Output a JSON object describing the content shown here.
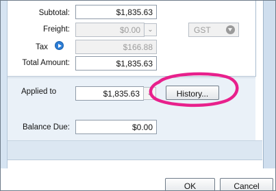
{
  "totals": {
    "subtotal_label": "Subtotal:",
    "subtotal_value": "$1,835.63",
    "freight_label": "Freight:",
    "freight_value": "$0.00",
    "freight_tax_code": "GST",
    "tax_label": "Tax",
    "tax_value": "$166.88",
    "total_label": "Total Amount:",
    "total_value": "$1,835.63"
  },
  "payment": {
    "applied_label": "Applied to",
    "applied_value": "$1,835.63",
    "history_button": "History...",
    "balance_label": "Balance Due:",
    "balance_value": "$0.00"
  },
  "footer": {
    "ok_button": "OK",
    "cancel_button": "Cancel"
  },
  "icons": {
    "tax_detail": "arrow-right-circle-icon",
    "dropdown": "chevron-down-icon"
  },
  "colors": {
    "annotation": "#e8208c",
    "panel_blue": "#eaf1f8",
    "tax_arrow": "#2c7dd6"
  }
}
